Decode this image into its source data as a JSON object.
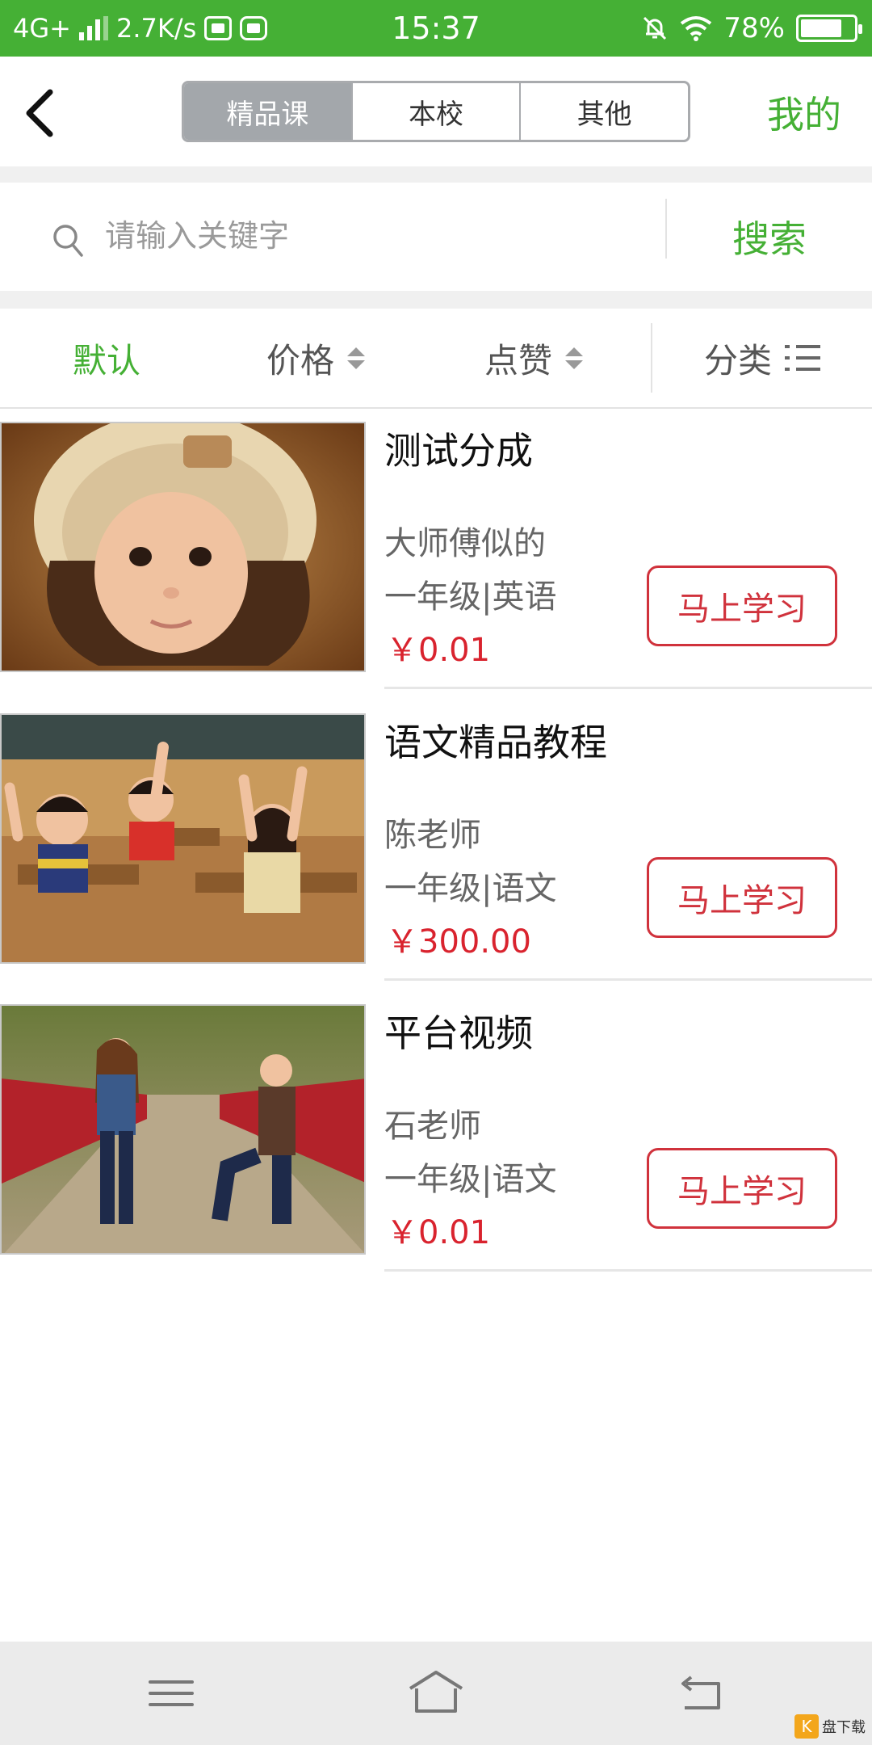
{
  "status_bar": {
    "network": "4G+",
    "speed": "2.7K/s",
    "time": "15:37",
    "battery": "78%",
    "battery_level": 0.78,
    "icons": [
      "signal-icon",
      "vivo-app-icon",
      "browser-app-icon",
      "mute-icon",
      "wifi-icon",
      "battery-icon"
    ]
  },
  "header": {
    "back_icon": "back-arrow-icon",
    "tabs": [
      {
        "label": "精品课",
        "active": true
      },
      {
        "label": "本校",
        "active": false
      },
      {
        "label": "其他",
        "active": false
      }
    ],
    "mine_label": "我的"
  },
  "search": {
    "placeholder": "请输入关键字",
    "value": "",
    "button_label": "搜索",
    "icon": "search-icon"
  },
  "filter": {
    "default_label": "默认",
    "price_label": "价格",
    "like_label": "点赞",
    "category_label": "分类",
    "active": "默认"
  },
  "courses": [
    {
      "title": "测试分成",
      "teacher": "大师傅似的",
      "grade": "一年级|英语",
      "price": "￥0.01",
      "button": "马上学习",
      "image": "photo of baby in fur hat"
    },
    {
      "title": "语文精品教程",
      "teacher": "陈老师",
      "grade": "一年级|语文",
      "price": "￥300.00",
      "button": "马上学习",
      "image": "photo of children raising hands in classroom"
    },
    {
      "title": "平台视频",
      "teacher": "石老师",
      "grade": "一年级|语文",
      "price": "￥0.01",
      "button": "马上学习",
      "image": "photo of man kneeling to woman on bridge"
    }
  ],
  "nav_bar": {
    "icons": [
      "menu-icon",
      "home-icon",
      "back-icon"
    ]
  },
  "colors": {
    "brand_green": "#45b035",
    "price_red": "#d9232e",
    "button_red": "#d0323c",
    "segment_active": "#a3a7ab"
  },
  "watermark": {
    "label": "盘下载"
  }
}
